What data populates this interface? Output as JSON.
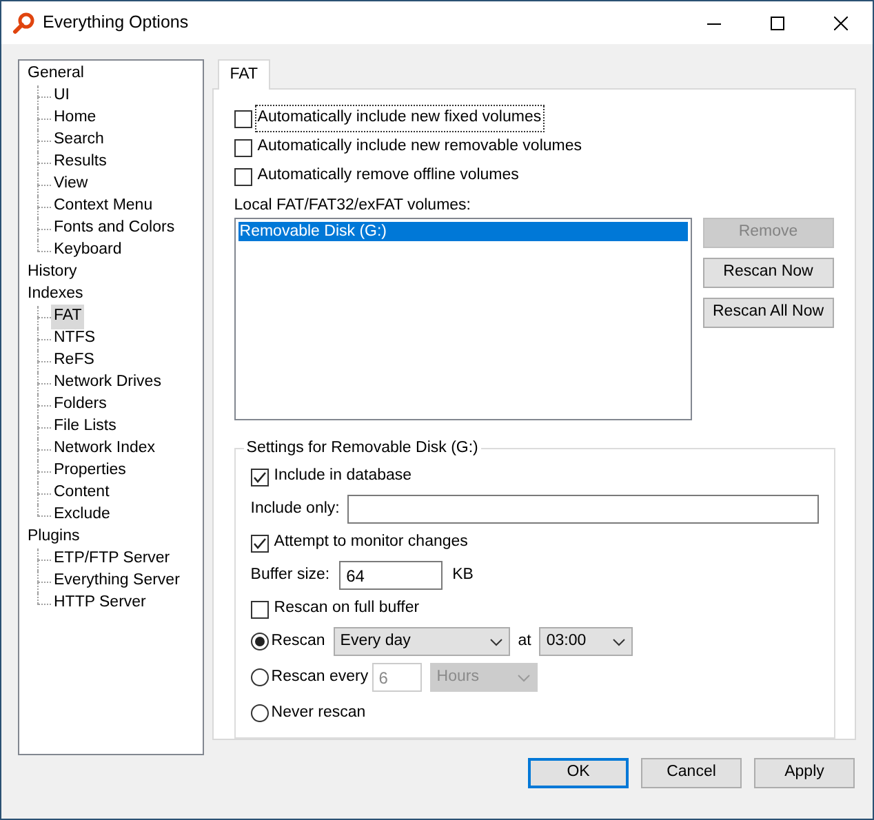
{
  "window": {
    "title": "Everything Options"
  },
  "tree": [
    {
      "label": "General",
      "selected": false,
      "children": [
        {
          "label": "UI",
          "selected": false
        },
        {
          "label": "Home",
          "selected": false
        },
        {
          "label": "Search",
          "selected": false
        },
        {
          "label": "Results",
          "selected": false
        },
        {
          "label": "View",
          "selected": false
        },
        {
          "label": "Context Menu",
          "selected": false
        },
        {
          "label": "Fonts and Colors",
          "selected": false
        },
        {
          "label": "Keyboard",
          "selected": false
        }
      ]
    },
    {
      "label": "History",
      "selected": false
    },
    {
      "label": "Indexes",
      "selected": false,
      "children": [
        {
          "label": "FAT",
          "selected": true
        },
        {
          "label": "NTFS",
          "selected": false
        },
        {
          "label": "ReFS",
          "selected": false
        },
        {
          "label": "Network Drives",
          "selected": false
        },
        {
          "label": "Folders",
          "selected": false
        },
        {
          "label": "File Lists",
          "selected": false
        },
        {
          "label": "Network Index",
          "selected": false
        },
        {
          "label": "Properties",
          "selected": false
        },
        {
          "label": "Content",
          "selected": false
        },
        {
          "label": "Exclude",
          "selected": false
        }
      ]
    },
    {
      "label": "Plugins",
      "selected": false,
      "children": [
        {
          "label": "ETP/FTP Server",
          "selected": false
        },
        {
          "label": "Everything Server",
          "selected": false
        },
        {
          "label": "HTTP Server",
          "selected": false
        }
      ]
    }
  ],
  "tabs": [
    {
      "label": "FAT",
      "selected": true
    }
  ],
  "options": [
    {
      "label": "Automatically include new fixed volumes",
      "checked": false,
      "focused": true
    },
    {
      "label": "Automatically include new removable volumes",
      "checked": false,
      "focused": false
    },
    {
      "label": "Automatically remove offline volumes",
      "checked": false,
      "focused": false
    }
  ],
  "volumes": {
    "label": "Local FAT/FAT32/exFAT volumes:",
    "items": [
      {
        "label": "Removable Disk (G:)",
        "selected": true
      }
    ]
  },
  "volume_buttons": [
    {
      "label": "Remove",
      "disabled": true
    },
    {
      "label": "Rescan Now",
      "disabled": false
    },
    {
      "label": "Rescan All Now",
      "disabled": false
    }
  ],
  "settings": {
    "title": "Settings for Removable Disk (G:)",
    "include_in_database": {
      "label": "Include in database",
      "checked": true
    },
    "include_only": {
      "label": "Include only:"
    },
    "monitor": {
      "label": "Attempt to monitor changes",
      "checked": true
    },
    "buffer_size": {
      "label": "Buffer size:",
      "value": "64",
      "unit": "KB"
    },
    "rescan_on_full": {
      "label": "Rescan on full buffer",
      "checked": false
    },
    "rescan_modes": [
      {
        "kind": "schedule",
        "label": "Rescan",
        "selected": true,
        "frequency": "Every day",
        "at_label": "at",
        "time": "03:00"
      },
      {
        "kind": "interval",
        "label": "Rescan every",
        "selected": false,
        "value": "6",
        "unit": "Hours"
      },
      {
        "kind": "never",
        "label": "Never rescan",
        "selected": false
      }
    ]
  },
  "buttons": [
    {
      "label": "OK",
      "default": true
    },
    {
      "label": "Cancel",
      "default": false
    },
    {
      "label": "Apply",
      "default": false
    }
  ]
}
